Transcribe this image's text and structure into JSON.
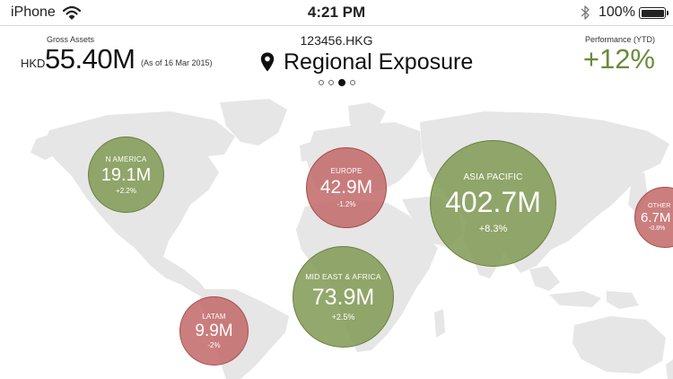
{
  "status_bar": {
    "carrier": "iPhone",
    "time": "4:21 PM",
    "battery_percent": "100%",
    "icons": [
      "wifi-icon",
      "bluetooth-icon",
      "battery-icon"
    ]
  },
  "header": {
    "gross_assets_label": "Gross Assets",
    "currency": "HKD",
    "gross_assets_value": "55.40M",
    "as_of": "(As of 16 Mar 2015)",
    "account_id": "123456.HKG",
    "title": "Regional Exposure",
    "title_icon": "map-pin-icon",
    "performance_label": "Performance (YTD)",
    "performance_value": "+12%"
  },
  "pagination": {
    "total": 4,
    "current": 3
  },
  "colors": {
    "positive": "#849c58",
    "negative": "#c46c6c",
    "positive_text": "#6b8a3c",
    "map_land": "#e6e6e6"
  },
  "regions": [
    {
      "name": "N AMERICA",
      "value": "19.1M",
      "change": "+2.2%",
      "trend": "positive"
    },
    {
      "name": "EUROPE",
      "value": "42.9M",
      "change": "-1.2%",
      "trend": "negative"
    },
    {
      "name": "ASIA PACIFIC",
      "value": "402.7M",
      "change": "+8.3%",
      "trend": "positive"
    },
    {
      "name": "OTHER",
      "value": "6.7M",
      "change": "-0.8%",
      "trend": "negative"
    },
    {
      "name": "MID EAST & AFRICA",
      "value": "73.9M",
      "change": "+2.5%",
      "trend": "positive"
    },
    {
      "name": "LATAM",
      "value": "9.9M",
      "change": "-2%",
      "trend": "negative"
    }
  ]
}
